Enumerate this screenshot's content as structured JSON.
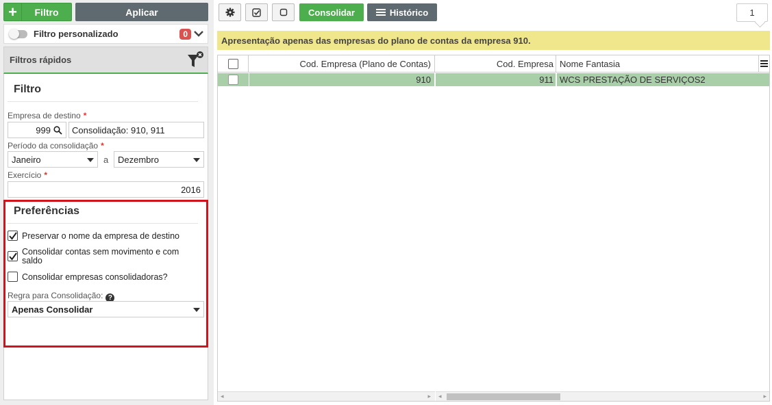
{
  "left": {
    "filtro_label": "Filtro",
    "aplicar_label": "Aplicar",
    "custom_filter_label": "Filtro personalizado",
    "custom_filter_count": "0",
    "quick_filters_title": "Filtros rápidos",
    "filtro_section_title": "Filtro",
    "empresa_label": "Empresa de destino",
    "empresa_code": "999",
    "empresa_name": "Consolidação: 910, 911",
    "periodo_label": "Período da consolidação",
    "periodo_from": "Janeiro",
    "periodo_sep": "a",
    "periodo_to": "Dezembro",
    "exercicio_label": "Exercício",
    "exercicio_value": "2016",
    "required_mark": "*",
    "preferencias_title": "Preferências",
    "pref_options": [
      {
        "label": "Preservar o nome da empresa de destino",
        "checked": true
      },
      {
        "label_line1": "Consolidar contas sem movimento e com",
        "label_line2": "saldo",
        "checked": true
      },
      {
        "label": "Consolidar empresas consolidadoras?",
        "checked": false
      }
    ],
    "regra_label": "Regra para Consolidação:",
    "regra_value": "Apenas Consolidar"
  },
  "toolbar": {
    "consolidar_label": "Consolidar",
    "historico_label": "Histórico",
    "page_number": "1"
  },
  "notice": "Apresentação apenas das empresas do plano de contas da empresa 910.",
  "grid": {
    "columns": [
      "Cod. Empresa (Plano de Contas)",
      "Cod. Empresa",
      "Nome Fantasia"
    ],
    "rows": [
      {
        "cod_plano": "910",
        "cod_empresa": "911",
        "nome_fantasia": "WCS PRESTAÇÃO DE SERVIÇOS2"
      }
    ]
  },
  "colors": {
    "green": "#4cae4c",
    "dark_button": "#5f6a70",
    "highlight_border": "#d0141e",
    "notice_bg": "#f0e68c",
    "selected_row": "#a9cfa9",
    "badge": "#d9534f"
  }
}
